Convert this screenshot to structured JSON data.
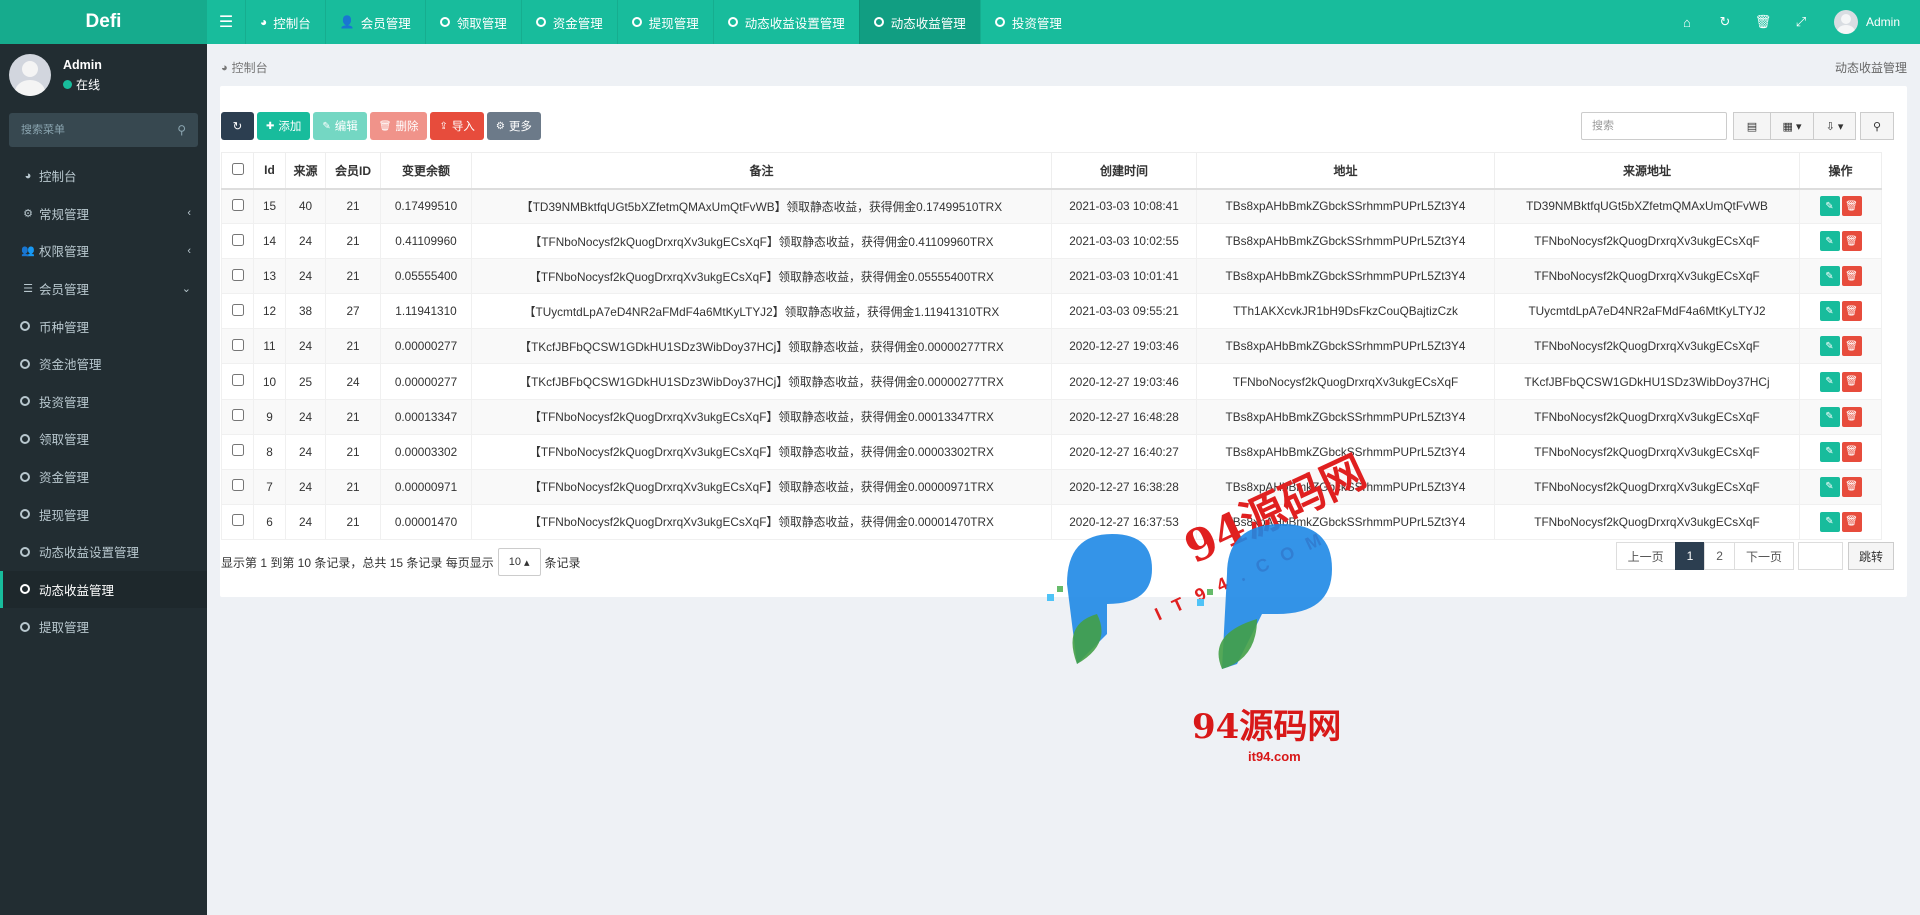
{
  "app": {
    "title": "Defi"
  },
  "top_nav": {
    "tabs": [
      {
        "label": "控制台",
        "icon": "dashboard-icon"
      },
      {
        "label": "会员管理",
        "icon": "user-icon"
      },
      {
        "label": "领取管理",
        "icon": "circle-icon"
      },
      {
        "label": "资金管理",
        "icon": "circle-icon"
      },
      {
        "label": "提现管理",
        "icon": "circle-icon"
      },
      {
        "label": "动态收益设置管理",
        "icon": "circle-icon"
      },
      {
        "label": "动态收益管理",
        "icon": "circle-icon",
        "active": true
      },
      {
        "label": "投资管理",
        "icon": "circle-icon"
      }
    ],
    "user": "Admin"
  },
  "sidebar": {
    "user_name": "Admin",
    "user_status": "在线",
    "search_placeholder": "搜索菜单",
    "items": [
      {
        "label": "控制台",
        "icon": "dashboard-icon"
      },
      {
        "label": "常规管理",
        "icon": "cogs-icon",
        "arrow": "‹"
      },
      {
        "label": "权限管理",
        "icon": "group-icon",
        "arrow": "‹"
      },
      {
        "label": "会员管理",
        "icon": "list-icon",
        "arrow": "⌄"
      },
      {
        "label": "币种管理",
        "icon": "circle-icon"
      },
      {
        "label": "资金池管理",
        "icon": "circle-icon"
      },
      {
        "label": "投资管理",
        "icon": "circle-icon"
      },
      {
        "label": "领取管理",
        "icon": "circle-icon"
      },
      {
        "label": "资金管理",
        "icon": "circle-icon"
      },
      {
        "label": "提现管理",
        "icon": "circle-icon"
      },
      {
        "label": "动态收益设置管理",
        "icon": "circle-icon"
      },
      {
        "label": "动态收益管理",
        "icon": "circle-icon",
        "active": true
      },
      {
        "label": "提取管理",
        "icon": "circle-icon"
      }
    ]
  },
  "breadcrumb": {
    "label": "控制台",
    "right": "动态收益管理"
  },
  "toolbar": {
    "add": "添加",
    "edit": "编辑",
    "delete": "删除",
    "import": "导入",
    "more": "更多",
    "search_placeholder": "搜索"
  },
  "table": {
    "headers": [
      "Id",
      "来源",
      "会员ID",
      "变更余额",
      "备注",
      "创建时间",
      "地址",
      "来源地址",
      "操作"
    ],
    "rows": [
      {
        "id": "15",
        "src": "40",
        "uid": "21",
        "amount": "0.17499510",
        "note": "【TD39NMBktfqUGt5bXZfetmQMAxUmQtFvWB】领取静态收益，获得佣金0.17499510TRX",
        "time": "2021-03-03 10:08:41",
        "addr": "TBs8xpAHbBmkZGbckSSrhmmPUPrL5Zt3Y4",
        "src_addr": "TD39NMBktfqUGt5bXZfetmQMAxUmQtFvWB"
      },
      {
        "id": "14",
        "src": "24",
        "uid": "21",
        "amount": "0.41109960",
        "note": "【TFNboNocysf2kQuogDrxrqXv3ukgECsXqF】领取静态收益，获得佣金0.41109960TRX",
        "time": "2021-03-03 10:02:55",
        "addr": "TBs8xpAHbBmkZGbckSSrhmmPUPrL5Zt3Y4",
        "src_addr": "TFNboNocysf2kQuogDrxrqXv3ukgECsXqF"
      },
      {
        "id": "13",
        "src": "24",
        "uid": "21",
        "amount": "0.05555400",
        "note": "【TFNboNocysf2kQuogDrxrqXv3ukgECsXqF】领取静态收益，获得佣金0.05555400TRX",
        "time": "2021-03-03 10:01:41",
        "addr": "TBs8xpAHbBmkZGbckSSrhmmPUPrL5Zt3Y4",
        "src_addr": "TFNboNocysf2kQuogDrxrqXv3ukgECsXqF"
      },
      {
        "id": "12",
        "src": "38",
        "uid": "27",
        "amount": "1.11941310",
        "note": "【TUycmtdLpA7eD4NR2aFMdF4a6MtKyLTYJ2】领取静态收益，获得佣金1.11941310TRX",
        "time": "2021-03-03 09:55:21",
        "addr": "TTh1AKXcvkJR1bH9DsFkzCouQBajtizCzk",
        "src_addr": "TUycmtdLpA7eD4NR2aFMdF4a6MtKyLTYJ2"
      },
      {
        "id": "11",
        "src": "24",
        "uid": "21",
        "amount": "0.00000277",
        "note": "【TKcfJBFbQCSW1GDkHU1SDz3WibDoy37HCj】领取静态收益，获得佣金0.00000277TRX",
        "time": "2020-12-27 19:03:46",
        "addr": "TBs8xpAHbBmkZGbckSSrhmmPUPrL5Zt3Y4",
        "src_addr": "TFNboNocysf2kQuogDrxrqXv3ukgECsXqF"
      },
      {
        "id": "10",
        "src": "25",
        "uid": "24",
        "amount": "0.00000277",
        "note": "【TKcfJBFbQCSW1GDkHU1SDz3WibDoy37HCj】领取静态收益，获得佣金0.00000277TRX",
        "time": "2020-12-27 19:03:46",
        "addr": "TFNboNocysf2kQuogDrxrqXv3ukgECsXqF",
        "src_addr": "TKcfJBFbQCSW1GDkHU1SDz3WibDoy37HCj"
      },
      {
        "id": "9",
        "src": "24",
        "uid": "21",
        "amount": "0.00013347",
        "note": "【TFNboNocysf2kQuogDrxrqXv3ukgECsXqF】领取静态收益，获得佣金0.00013347TRX",
        "time": "2020-12-27 16:48:28",
        "addr": "TBs8xpAHbBmkZGbckSSrhmmPUPrL5Zt3Y4",
        "src_addr": "TFNboNocysf2kQuogDrxrqXv3ukgECsXqF"
      },
      {
        "id": "8",
        "src": "24",
        "uid": "21",
        "amount": "0.00003302",
        "note": "【TFNboNocysf2kQuogDrxrqXv3ukgECsXqF】领取静态收益，获得佣金0.00003302TRX",
        "time": "2020-12-27 16:40:27",
        "addr": "TBs8xpAHbBmkZGbckSSrhmmPUPrL5Zt3Y4",
        "src_addr": "TFNboNocysf2kQuogDrxrqXv3ukgECsXqF"
      },
      {
        "id": "7",
        "src": "24",
        "uid": "21",
        "amount": "0.00000971",
        "note": "【TFNboNocysf2kQuogDrxrqXv3ukgECsXqF】领取静态收益，获得佣金0.00000971TRX",
        "time": "2020-12-27 16:38:28",
        "addr": "TBs8xpAHbBmkZGbckSSrhmmPUPrL5Zt3Y4",
        "src_addr": "TFNboNocysf2kQuogDrxrqXv3ukgECsXqF"
      },
      {
        "id": "6",
        "src": "24",
        "uid": "21",
        "amount": "0.00001470",
        "note": "【TFNboNocysf2kQuogDrxrqXv3ukgECsXqF】领取静态收益，获得佣金0.00001470TRX",
        "time": "2020-12-27 16:37:53",
        "addr": "TBs8xpAHbBmkZGbckSSrhmmPUPrL5Zt3Y4",
        "src_addr": "TFNboNocysf2kQuogDrxrqXv3ukgECsXqF"
      }
    ]
  },
  "pagination": {
    "info_prefix": "显示第 1 到第 10 条记录，总共 15 条记录 每页显示",
    "page_size": "10",
    "info_suffix": "条记录",
    "prev": "上一页",
    "pages": [
      "1",
      "2"
    ],
    "next": "下一页",
    "jump": "跳转"
  },
  "watermark": {
    "title": "94源码网",
    "sub": "IT94.COM",
    "bottom": "94源码网",
    "url": "it94.com"
  },
  "colors": {
    "primary": "#18bc9c",
    "sidebar": "#222d32",
    "danger": "#e74c3c",
    "dark": "#2c3e50"
  }
}
